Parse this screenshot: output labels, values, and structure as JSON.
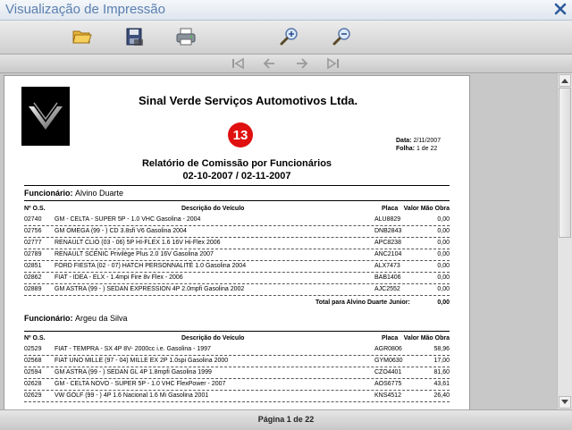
{
  "window": {
    "title": "Visualização de Impressão",
    "close_icon": "close-icon"
  },
  "toolbar": {
    "buttons": [
      "open-folder-icon",
      "save-disk-icon",
      "print-icon",
      "zoom-in-icon",
      "zoom-out-icon"
    ],
    "nav": [
      "first-page-icon",
      "previous-page-icon",
      "next-page-icon",
      "last-page-icon"
    ]
  },
  "report": {
    "company": "Sinal Verde Serviços Automotivos Ltda.",
    "badge": "13",
    "date_label": "Data:",
    "date_value": "2/11/2007",
    "sheet_label": "Folha:",
    "sheet_value": "1 de 22",
    "title": "Relatório de Comissão por Funcionários",
    "period": "02-10-2007 / 02-11-2007",
    "columns": {
      "os": "Nº O.S.",
      "desc": "Descrição do Veículo",
      "placa": "Placa",
      "valor": "Valor Mão Obra"
    },
    "groups": [
      {
        "label": "Funcionário:",
        "name": "Alvino Duarte",
        "rows": [
          {
            "os": "02740",
            "desc": "GM - CELTA - SUPER 5P - 1.0 VHC Gasolina - 2004",
            "placa": "ALU8829",
            "valor": "0,00"
          },
          {
            "os": "02756",
            "desc": "GM OMEGA (99 - ) CD 3.8sfi V6 Gasolina 2004",
            "placa": "DNB2843",
            "valor": "0,00"
          },
          {
            "os": "02777",
            "desc": "RENAULT CLIO (03 - 06) 5P HI-FLEX 1.6 16V Hi-Flex 2006",
            "placa": "APC8238",
            "valor": "0,00"
          },
          {
            "os": "02789",
            "desc": "RENAULT SCÉNIC Privilège Plus 2.0 16V Gasolina 2007",
            "placa": "ANC2104",
            "valor": "0,00"
          },
          {
            "os": "02851",
            "desc": "FORD FIESTA (02 - 07) HATCH PERSONNALITÉ 1.0 Gasolina 2004",
            "placa": "ALX7473",
            "valor": "0,00"
          },
          {
            "os": "02862",
            "desc": "FIAT - IDEA - ELX - 1.4mpi Fire 8v Flex - 2006",
            "placa": "BAB1406",
            "valor": "0,00"
          },
          {
            "os": "02889",
            "desc": "GM ASTRA (99 - ) SEDAN EXPRESSION 4P 2.0mpfi Gasolina 2002",
            "placa": "AJC2552",
            "valor": "0,00"
          }
        ],
        "total_label": "Total para Alvino Duarte Junior:",
        "total_value": "0,00"
      },
      {
        "label": "Funcionário:",
        "name": "Argeu da Silva",
        "rows": [
          {
            "os": "02529",
            "desc": "FIAT - TEMPRA - SX 4P 8V- 2000cc i.e. Gasolina - 1997",
            "placa": "AGR0806",
            "valor": "58,96"
          },
          {
            "os": "02568",
            "desc": "FIAT UNO MILLE (97 - 04) MILLE EX 2P 1.0spi Gasolina 2000",
            "placa": "GYM0630",
            "valor": "17,00"
          },
          {
            "os": "02594",
            "desc": "GM ASTRA (99 - ) SEDAN GL 4P 1.8mpfi Gasolina 1999",
            "placa": "CZO4401",
            "valor": "81,60"
          },
          {
            "os": "02628",
            "desc": "GM - CELTA NOVO - SUPER 5P - 1.0 VHC FlexPower - 2007",
            "placa": "AOS6775",
            "valor": "43,61"
          },
          {
            "os": "02629",
            "desc": "VW GOLF (99 - ) 4P 1.6 Nacional 1.6 Mi Gasolina 2001",
            "placa": "KNS4512",
            "valor": "26,40"
          }
        ]
      }
    ]
  },
  "status": {
    "page": "Página 1 de 22"
  }
}
